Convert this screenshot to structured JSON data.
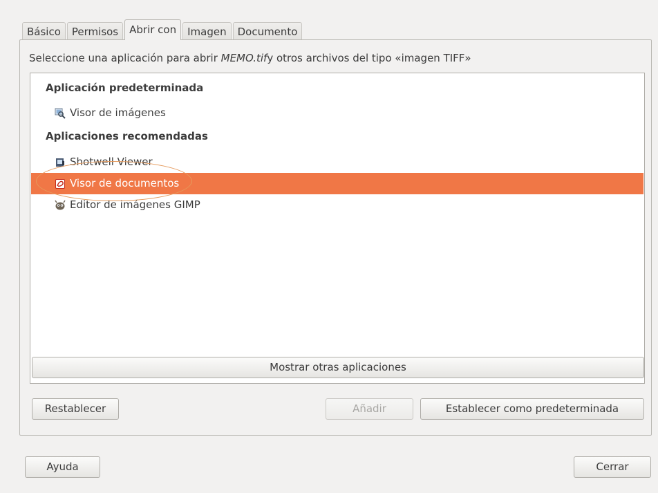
{
  "tabs": [
    {
      "label": "Básico"
    },
    {
      "label": "Permisos"
    },
    {
      "label": "Abrir con"
    },
    {
      "label": "Imagen"
    },
    {
      "label": "Documento"
    }
  ],
  "description": {
    "prefix": "Seleccione una aplicación para abrir ",
    "filename": "MEMO.tif",
    "suffix": "y otros archivos del tipo «imagen TIFF»"
  },
  "list": {
    "default_header": "Aplicación predeterminada",
    "default_app": {
      "label": "Visor de imágenes",
      "icon": "image-viewer-icon"
    },
    "recommended_header": "Aplicaciones recomendadas",
    "recommended_apps": [
      {
        "label": "Shotwell Viewer",
        "icon": "shotwell-icon"
      },
      {
        "label": "Visor de documentos",
        "icon": "document-viewer-icon",
        "selected": true
      },
      {
        "label": "Editor de imágenes GIMP",
        "icon": "gimp-icon"
      }
    ]
  },
  "buttons": {
    "show_other": "Mostrar otras aplicaciones",
    "reset": "Restablecer",
    "add": "Añadir",
    "set_default": "Establecer como predeterminada",
    "help": "Ayuda",
    "close": "Cerrar"
  },
  "colors": {
    "selection": "#f07746",
    "highlight_ellipse": "#e59a5c"
  }
}
